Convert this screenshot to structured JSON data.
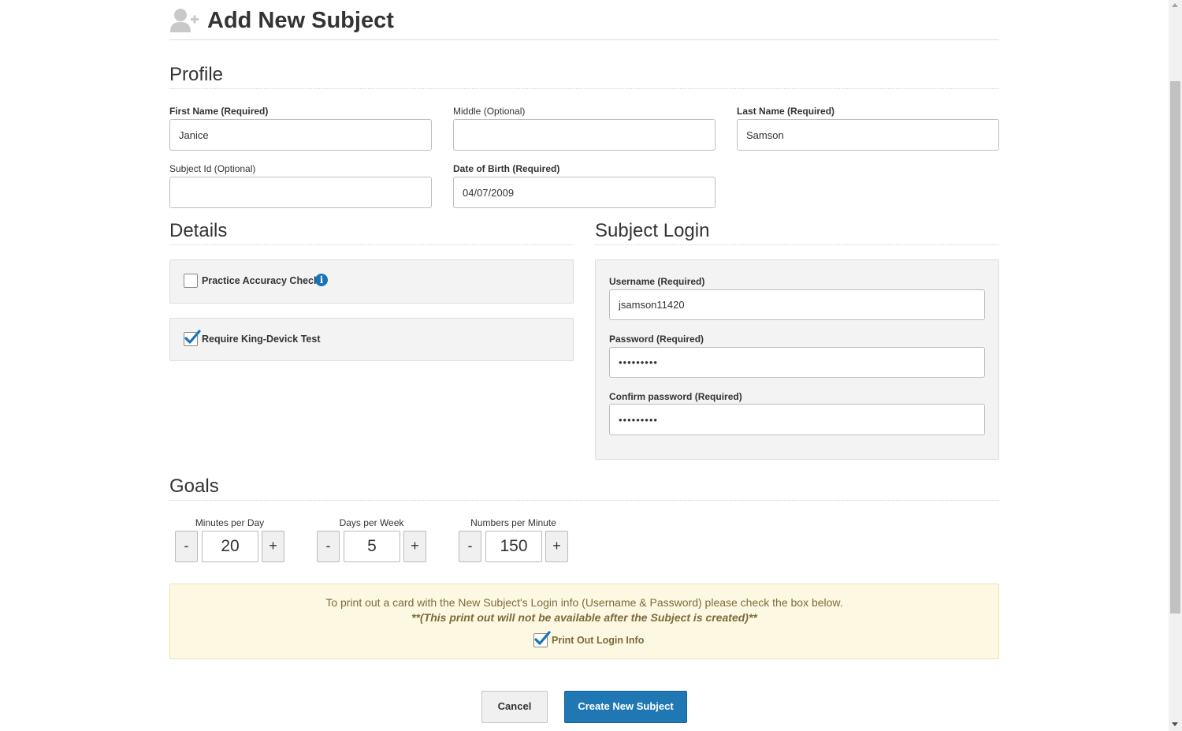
{
  "header": {
    "title": "Add New Subject",
    "icon": "add-user-icon"
  },
  "profile": {
    "section_title": "Profile",
    "first_name": {
      "label_main": "First Name",
      "label_suffix": " (Required)",
      "value": "Janice"
    },
    "middle": {
      "label_main": "Middle",
      "label_suffix": " (Optional)",
      "value": ""
    },
    "last_name": {
      "label_main": "Last Name",
      "label_suffix": " (Required)",
      "value": "Samson"
    },
    "subject_id": {
      "label_main": "Subject Id",
      "label_suffix": " (Optional)",
      "value": ""
    },
    "dob": {
      "label_main": "Date of Birth",
      "label_suffix": " (Required)",
      "value": "04/07/2009"
    }
  },
  "details": {
    "section_title": "Details",
    "practice_accuracy": {
      "label": "Practice Accuracy Check",
      "checked": false
    },
    "king_devick": {
      "label": "Require King-Devick Test",
      "checked": true
    }
  },
  "login": {
    "section_title": "Subject Login",
    "username": {
      "label_main": "Username",
      "label_suffix": " (Required)",
      "value": "jsamson11420"
    },
    "password": {
      "label_main": "Password",
      "label_suffix": " (Required)",
      "value": "•••••••••"
    },
    "confirm": {
      "label_main": "Confirm password",
      "label_suffix": " (Required)",
      "value": "•••••••••"
    }
  },
  "goals": {
    "section_title": "Goals",
    "minus": "-",
    "plus": "+",
    "minutes": {
      "label": "Minutes per Day",
      "value": "20"
    },
    "days": {
      "label": "Days per Week",
      "value": "5"
    },
    "numbers": {
      "label": "Numbers per Minute",
      "value": "150"
    }
  },
  "notice": {
    "line1": "To print out a card with the New Subject's Login info (Username & Password) please check the box below.",
    "line2": "**(This print out will not be available after the Subject is created)**",
    "print_label": "Print Out Login Info",
    "print_checked": true
  },
  "actions": {
    "cancel": "Cancel",
    "create": "Create New Subject"
  },
  "colors": {
    "primary": "#1f78b4",
    "notice_bg": "#fdf8e2",
    "check": "#1a73b8"
  }
}
